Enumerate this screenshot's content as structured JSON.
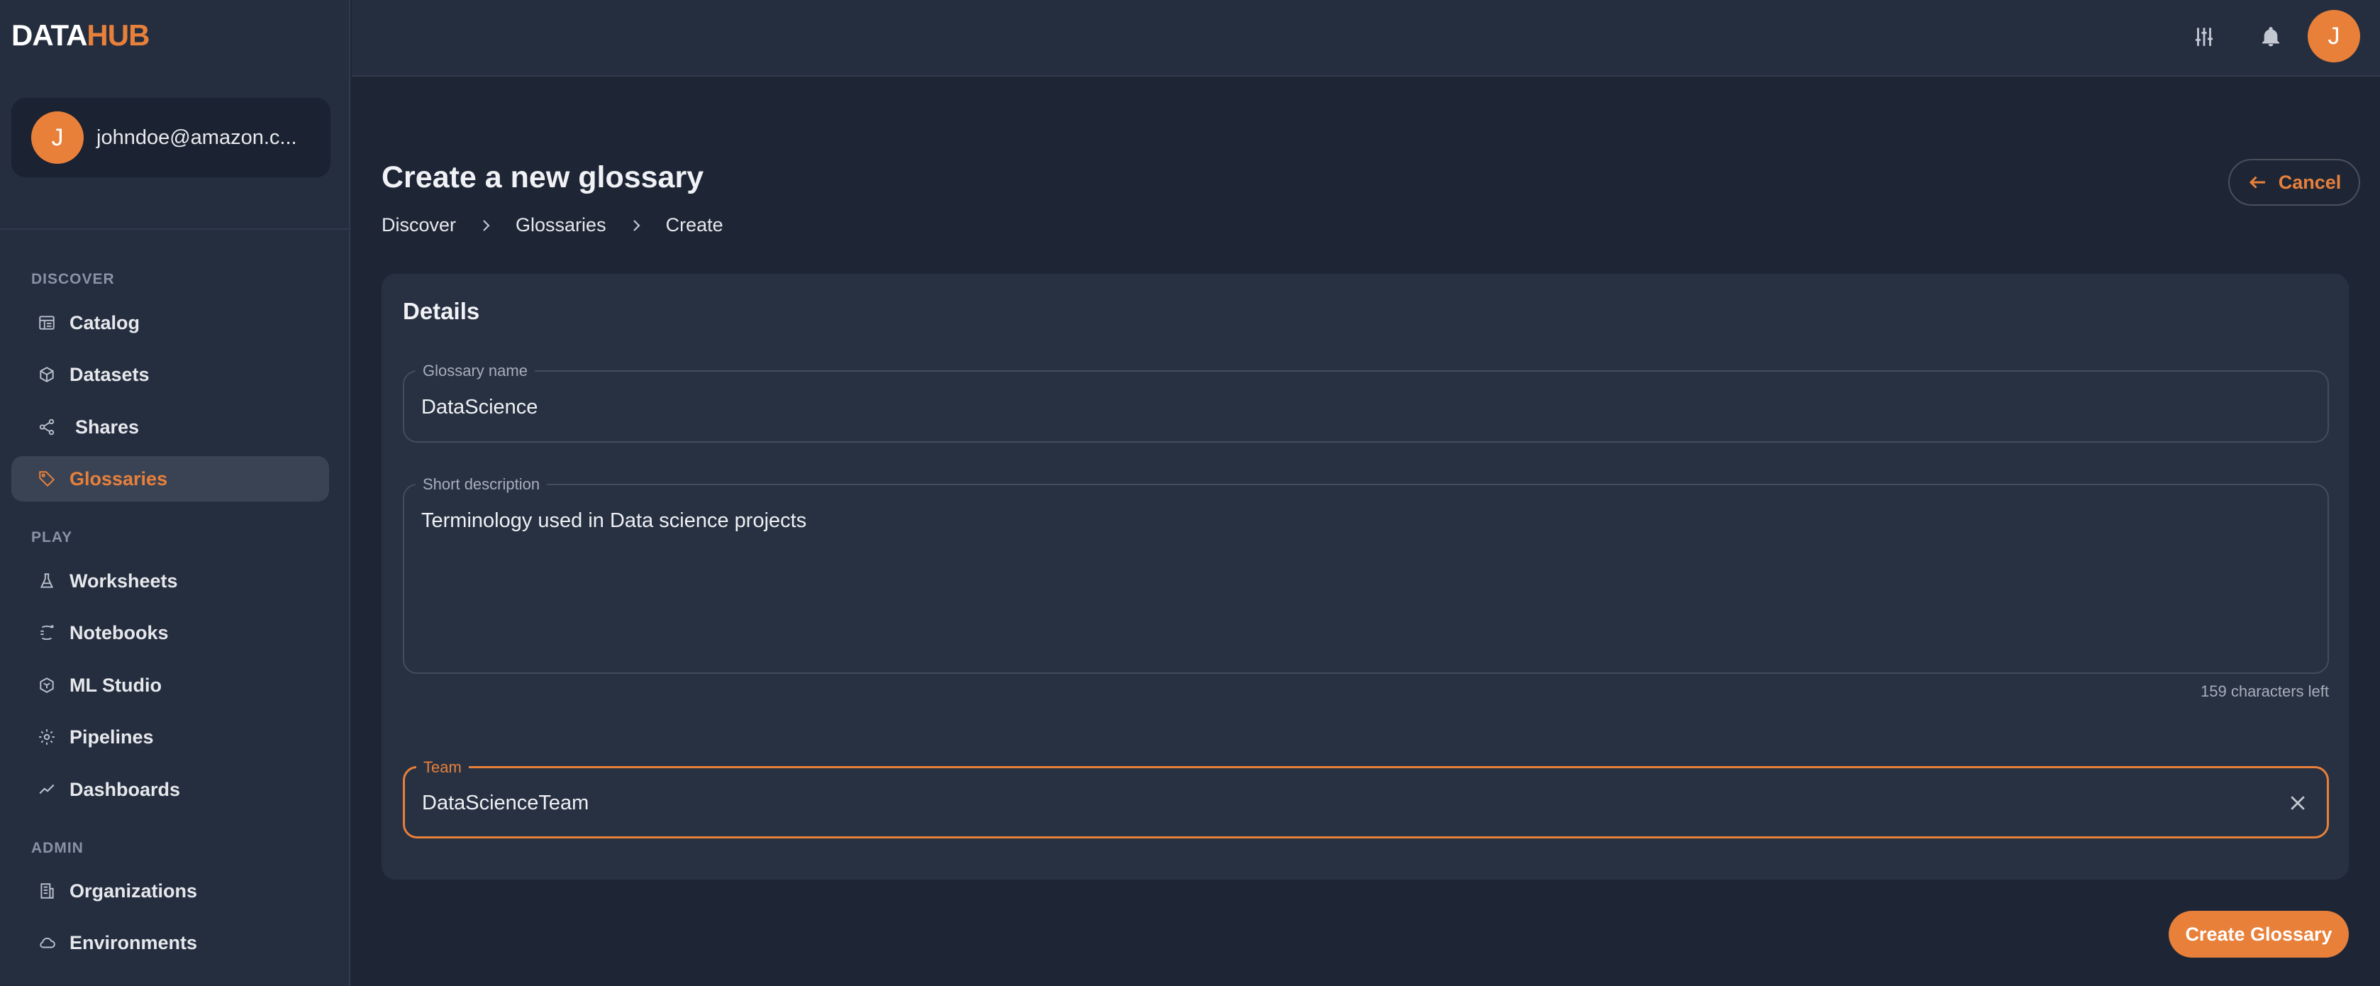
{
  "app": {
    "logo_part1": "DATA",
    "logo_part2": "HUB"
  },
  "user": {
    "initial": "J",
    "email": "johndoe@amazon.c..."
  },
  "sidebar": {
    "sections": [
      {
        "title": "DISCOVER"
      },
      {
        "title": "PLAY"
      },
      {
        "title": "ADMIN"
      }
    ],
    "items": [
      {
        "label": "Catalog",
        "icon": "catalog-icon"
      },
      {
        "label": "Datasets",
        "icon": "cube-icon"
      },
      {
        "label": "Shares",
        "icon": "share-icon"
      },
      {
        "label": "Glossaries",
        "icon": "tag-icon",
        "active": true
      },
      {
        "label": "Worksheets",
        "icon": "flask-icon"
      },
      {
        "label": "Notebooks",
        "icon": "notebook-icon"
      },
      {
        "label": "ML Studio",
        "icon": "ml-icon"
      },
      {
        "label": "Pipelines",
        "icon": "gear-icon"
      },
      {
        "label": "Dashboards",
        "icon": "chart-line-icon"
      },
      {
        "label": "Organizations",
        "icon": "building-icon"
      },
      {
        "label": "Environments",
        "icon": "cloud-icon"
      }
    ]
  },
  "header": {
    "avatar_initial": "J",
    "icons": [
      "settings-sliders-icon",
      "bell-icon"
    ]
  },
  "page": {
    "title": "Create a new glossary",
    "breadcrumb": [
      "Discover",
      "Glossaries",
      "Create"
    ],
    "cancel_label": "Cancel"
  },
  "form": {
    "card_title": "Details",
    "name_label": "Glossary name",
    "name_value": "DataScience",
    "description_label": "Short description",
    "description_value": "Terminology used in Data science projects",
    "description_helper": "159 characters left",
    "team_label": "Team",
    "team_value": "DataScienceTeam",
    "submit_label": "Create Glossary"
  },
  "colors": {
    "accent": "#e8803a",
    "background": "#1e2636",
    "sidebar": "#252e3f",
    "card": "#283142"
  }
}
